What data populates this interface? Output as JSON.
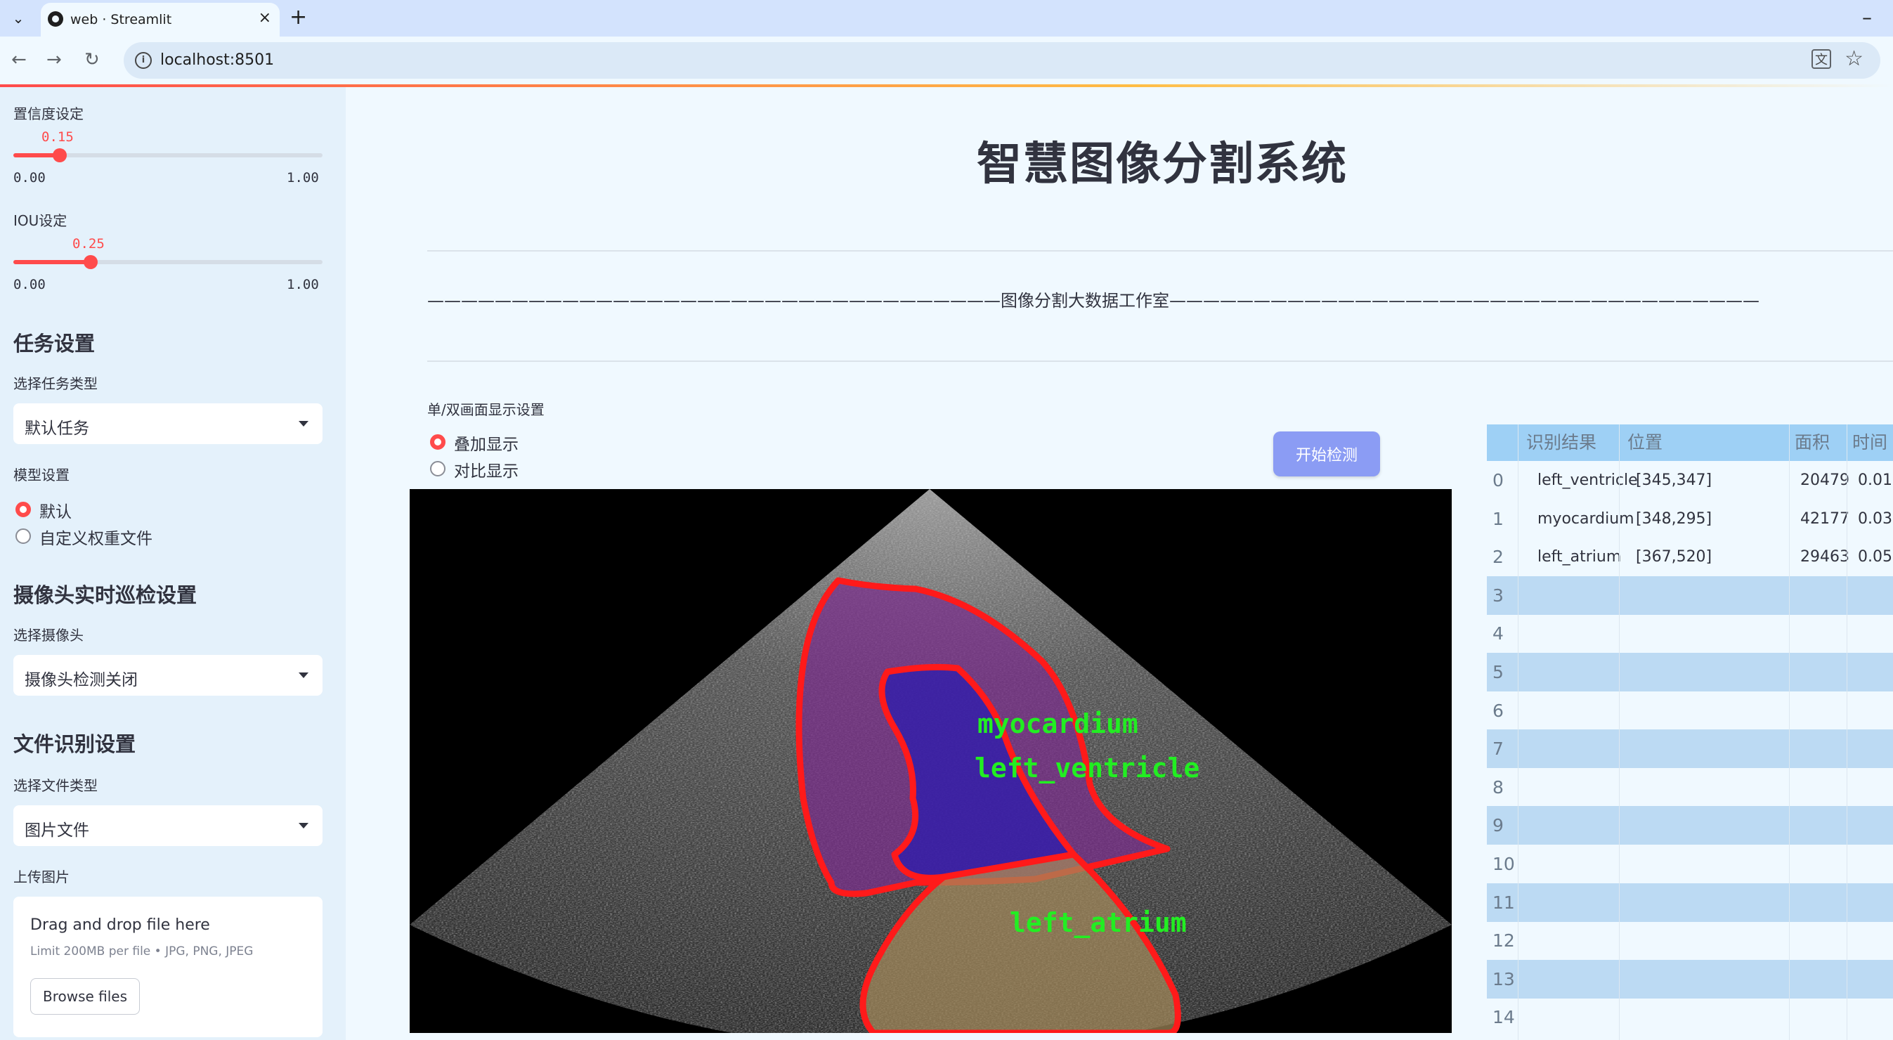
{
  "browser": {
    "tab_title": "web · Streamlit",
    "url": "localhost:8501",
    "new_tab": "+",
    "close": "×",
    "minimize": "–"
  },
  "sidebar": {
    "confidence": {
      "label": "置信度设定",
      "value": "0.15",
      "level": 0.15,
      "min": "0.00",
      "max": "1.00"
    },
    "iou": {
      "label": "IOU设定",
      "value": "0.25",
      "level": 0.25,
      "min": "0.00",
      "max": "1.00"
    },
    "task_section": {
      "title": "任务设置",
      "select_label": "选择任务类型",
      "select_value": "默认任务"
    },
    "model": {
      "label": "模型设置",
      "options": [
        "默认",
        "自定义权重文件"
      ],
      "selected": 0
    },
    "camera_section": {
      "title": "摄像头实时巡检设置",
      "select_label": "选择摄像头",
      "select_value": "摄像头检测关闭"
    },
    "file_section": {
      "title": "文件识别设置",
      "select_label": "选择文件类型",
      "select_value": "图片文件"
    },
    "upload": {
      "label": "上传图片",
      "title": "Drag and drop file here",
      "limit": "Limit 200MB per file • JPG, PNG, JPEG",
      "button": "Browse files"
    }
  },
  "main": {
    "title": "智慧图像分割系统",
    "studio_banner": "——————————————————————————————————图像分割大数据工作室———————————————————————————————————",
    "display_label": "单/双画面显示设置",
    "display_options": [
      "叠加显示",
      "对比显示"
    ],
    "display_selected": 0,
    "detect_button": "开始检测",
    "overlay_labels": [
      "myocardium",
      "left_ventricle",
      "left_atrium"
    ]
  },
  "results_table": {
    "columns": [
      "识别结果",
      "位置",
      "面积",
      "时间"
    ],
    "rows": [
      {
        "index": "0",
        "result": "left_ventricle",
        "position": "[345,347]",
        "area": "20479",
        "time": "0.01"
      },
      {
        "index": "1",
        "result": "myocardium",
        "position": "[348,295]",
        "area": "42177",
        "time": "0.03"
      },
      {
        "index": "2",
        "result": "left_atrium",
        "position": "[367,520]",
        "area": "29463",
        "time": "0.05"
      },
      {
        "index": "3"
      },
      {
        "index": "4"
      },
      {
        "index": "5"
      },
      {
        "index": "6"
      },
      {
        "index": "7"
      },
      {
        "index": "8"
      },
      {
        "index": "9"
      },
      {
        "index": "10"
      },
      {
        "index": "11"
      },
      {
        "index": "12"
      },
      {
        "index": "13"
      },
      {
        "index": "14"
      }
    ]
  },
  "colors": {
    "accent": "#ff4b4b",
    "button": "#8b9cf4",
    "mask_outline": "#ff1a1a",
    "label_green": "#22ee22",
    "myocardium_fill": "#7a2d8c",
    "ventricle_fill": "#2a1ab0",
    "atrium_fill": "#a4895a"
  }
}
